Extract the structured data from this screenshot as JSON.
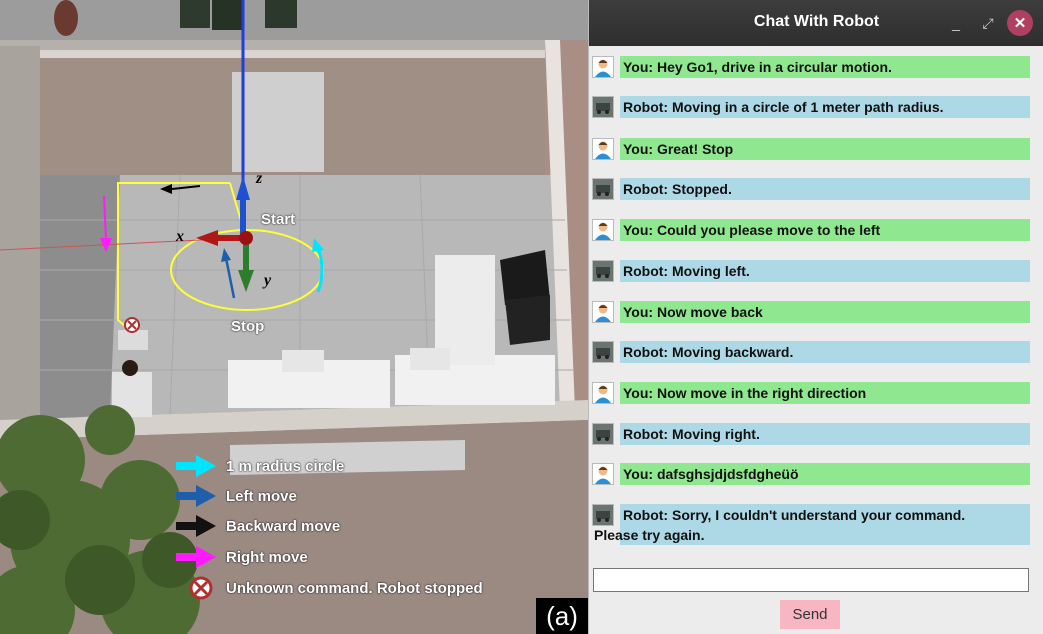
{
  "scene": {
    "start_label": "Start",
    "stop_label": "Stop",
    "axes": {
      "x": "x",
      "y": "y",
      "z": "z"
    },
    "legend": [
      {
        "label": "1 m radius circle",
        "arrow_color": "#00e5ff",
        "icon": "arrow-right-icon"
      },
      {
        "label": "Left move",
        "arrow_color": "#1f5faa",
        "icon": "arrow-right-icon"
      },
      {
        "label": "Backward move",
        "arrow_color": "#111111",
        "icon": "arrow-right-icon"
      },
      {
        "label": "Right move",
        "arrow_color": "#ff1aff",
        "icon": "arrow-right-icon"
      },
      {
        "label": "Unknown command. Robot stopped",
        "arrow_color": "#c0392b",
        "icon": "stop-x-icon"
      }
    ],
    "panel_tag": "(a)"
  },
  "chat": {
    "title": "Chat With Robot",
    "window_controls": {
      "minimize": "_",
      "maximize": "⤢",
      "close": "✕"
    },
    "messages": [
      {
        "sender": "you",
        "text": "You: Hey Go1, drive in a circular motion."
      },
      {
        "sender": "robot",
        "text": "Robot:  Moving in a circle of 1 meter path radius."
      },
      {
        "sender": "you",
        "text": "You: Great! Stop"
      },
      {
        "sender": "robot",
        "text": "Robot: Stopped."
      },
      {
        "sender": "you",
        "text": "You: Could you please move to the left"
      },
      {
        "sender": "robot",
        "text": "Robot: Moving left."
      },
      {
        "sender": "you",
        "text": "You: Now move back"
      },
      {
        "sender": "robot",
        "text": "Robot: Moving backward."
      },
      {
        "sender": "you",
        "text": "You: Now move in the right direction"
      },
      {
        "sender": "robot",
        "text": "Robot: Moving right."
      },
      {
        "sender": "you",
        "text": "You: dafsghsjdjdsfdgheüö"
      },
      {
        "sender": "robot",
        "text": "Robot: Sorry, I couldn't understand your command.",
        "text2": "Please try again."
      }
    ],
    "input_value": "",
    "send_label": "Send"
  }
}
